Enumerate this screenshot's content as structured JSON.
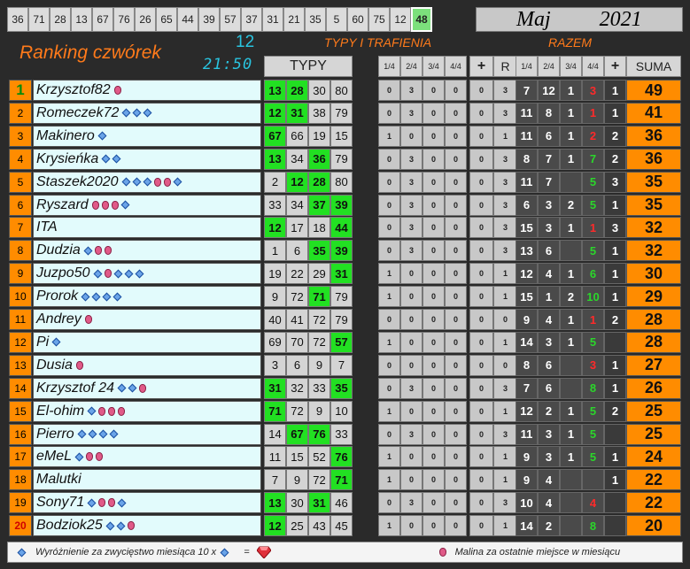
{
  "top_numbers": [
    "36",
    "71",
    "28",
    "13",
    "67",
    "76",
    "26",
    "65",
    "44",
    "39",
    "57",
    "37",
    "31",
    "21",
    "35",
    "5",
    "60",
    "75",
    "12",
    "48"
  ],
  "highlight_number": "48",
  "month": "Maj",
  "year": "2021",
  "title": "Ranking czwórek",
  "big_number": "12",
  "time": "21:50",
  "typy_trafienia": "TYPY I TRAFIENIA",
  "razem": "RAZEM",
  "headers": {
    "typy": "TYPY",
    "cols_left": [
      "1/4",
      "2/4",
      "3/4",
      "4/4",
      "+",
      "R"
    ],
    "cols_right": [
      "1/4",
      "2/4",
      "3/4",
      "4/4",
      "+",
      "SUMA"
    ]
  },
  "rows": [
    {
      "rank": "1",
      "name": "Krzysztof82",
      "icons": "r",
      "typy": [
        [
          "13",
          true
        ],
        [
          "28",
          true
        ],
        [
          "30",
          false
        ],
        [
          "80",
          false
        ]
      ],
      "left": [
        "0",
        "3",
        "0",
        "0",
        "0",
        "3"
      ],
      "right": [
        [
          "7",
          ""
        ],
        [
          "12",
          ""
        ],
        [
          "1",
          ""
        ],
        [
          "3",
          "red"
        ]
      ],
      "plus": "1",
      "suma": "49"
    },
    {
      "rank": "2",
      "name": "Romeczek72",
      "icons": "ddd",
      "typy": [
        [
          "12",
          true
        ],
        [
          "31",
          true
        ],
        [
          "38",
          false
        ],
        [
          "79",
          false
        ]
      ],
      "left": [
        "0",
        "3",
        "0",
        "0",
        "0",
        "3"
      ],
      "right": [
        [
          "11",
          ""
        ],
        [
          "8",
          ""
        ],
        [
          "1",
          ""
        ],
        [
          "1",
          "red"
        ]
      ],
      "plus": "1",
      "suma": "41"
    },
    {
      "rank": "3",
      "name": "Makinero",
      "icons": "d",
      "typy": [
        [
          "67",
          true
        ],
        [
          "66",
          false
        ],
        [
          "19",
          false
        ],
        [
          "15",
          false
        ]
      ],
      "left": [
        "1",
        "0",
        "0",
        "0",
        "0",
        "1"
      ],
      "right": [
        [
          "11",
          ""
        ],
        [
          "6",
          ""
        ],
        [
          "1",
          ""
        ],
        [
          "2",
          "red"
        ]
      ],
      "plus": "2",
      "suma": "36"
    },
    {
      "rank": "4",
      "name": "Krysieńka",
      "icons": "dd",
      "typy": [
        [
          "13",
          true
        ],
        [
          "34",
          false
        ],
        [
          "36",
          true
        ],
        [
          "79",
          false
        ]
      ],
      "left": [
        "0",
        "3",
        "0",
        "0",
        "0",
        "3"
      ],
      "right": [
        [
          "8",
          ""
        ],
        [
          "7",
          ""
        ],
        [
          "1",
          ""
        ],
        [
          "7",
          "grn"
        ]
      ],
      "plus": "2",
      "suma": "36"
    },
    {
      "rank": "5",
      "name": "Staszek2020",
      "icons": "dddrrd",
      "typy": [
        [
          "2",
          false
        ],
        [
          "12",
          true
        ],
        [
          "28",
          true
        ],
        [
          "80",
          false
        ]
      ],
      "left": [
        "0",
        "3",
        "0",
        "0",
        "0",
        "3"
      ],
      "right": [
        [
          "11",
          ""
        ],
        [
          "7",
          ""
        ],
        [
          "",
          ""
        ],
        [
          "5",
          "grn"
        ]
      ],
      "plus": "3",
      "suma": "35"
    },
    {
      "rank": "6",
      "name": "Ryszard",
      "icons": "rrrd",
      "typy": [
        [
          "33",
          false
        ],
        [
          "34",
          false
        ],
        [
          "37",
          true
        ],
        [
          "39",
          true
        ]
      ],
      "left": [
        "0",
        "3",
        "0",
        "0",
        "0",
        "3"
      ],
      "right": [
        [
          "6",
          ""
        ],
        [
          "3",
          ""
        ],
        [
          "2",
          ""
        ],
        [
          "5",
          "grn"
        ]
      ],
      "plus": "1",
      "suma": "35"
    },
    {
      "rank": "7",
      "name": "ITA",
      "icons": "",
      "typy": [
        [
          "12",
          true
        ],
        [
          "17",
          false
        ],
        [
          "18",
          false
        ],
        [
          "44",
          true
        ]
      ],
      "left": [
        "0",
        "3",
        "0",
        "0",
        "0",
        "3"
      ],
      "right": [
        [
          "15",
          ""
        ],
        [
          "3",
          ""
        ],
        [
          "1",
          ""
        ],
        [
          "1",
          "red"
        ]
      ],
      "plus": "3",
      "suma": "32"
    },
    {
      "rank": "8",
      "name": "Dudzia",
      "icons": "drr",
      "typy": [
        [
          "1",
          false
        ],
        [
          "6",
          false
        ],
        [
          "35",
          true
        ],
        [
          "39",
          true
        ]
      ],
      "left": [
        "0",
        "3",
        "0",
        "0",
        "0",
        "3"
      ],
      "right": [
        [
          "13",
          ""
        ],
        [
          "6",
          ""
        ],
        [
          "",
          ""
        ],
        [
          "5",
          "grn"
        ]
      ],
      "plus": "1",
      "suma": "32"
    },
    {
      "rank": "9",
      "name": "Juzpo50",
      "icons": "drddd",
      "typy": [
        [
          "19",
          false
        ],
        [
          "22",
          false
        ],
        [
          "29",
          false
        ],
        [
          "31",
          true
        ]
      ],
      "left": [
        "1",
        "0",
        "0",
        "0",
        "0",
        "1"
      ],
      "right": [
        [
          "12",
          ""
        ],
        [
          "4",
          ""
        ],
        [
          "1",
          ""
        ],
        [
          "6",
          "grn"
        ]
      ],
      "plus": "1",
      "suma": "30"
    },
    {
      "rank": "10",
      "name": "Prorok",
      "icons": "dddd",
      "typy": [
        [
          "9",
          false
        ],
        [
          "72",
          false
        ],
        [
          "71",
          true
        ],
        [
          "79",
          false
        ]
      ],
      "left": [
        "1",
        "0",
        "0",
        "0",
        "0",
        "1"
      ],
      "right": [
        [
          "15",
          ""
        ],
        [
          "1",
          ""
        ],
        [
          "2",
          ""
        ],
        [
          "10",
          "grn"
        ]
      ],
      "plus": "1",
      "suma": "29"
    },
    {
      "rank": "11",
      "name": "Andrey",
      "icons": "r",
      "typy": [
        [
          "40",
          false
        ],
        [
          "41",
          false
        ],
        [
          "72",
          false
        ],
        [
          "79",
          false
        ]
      ],
      "left": [
        "0",
        "0",
        "0",
        "0",
        "0",
        "0"
      ],
      "right": [
        [
          "9",
          ""
        ],
        [
          "4",
          ""
        ],
        [
          "1",
          ""
        ],
        [
          "1",
          "red"
        ]
      ],
      "plus": "2",
      "suma": "28"
    },
    {
      "rank": "12",
      "name": "Pi",
      "icons": "d",
      "typy": [
        [
          "69",
          false
        ],
        [
          "70",
          false
        ],
        [
          "72",
          false
        ],
        [
          "57",
          true
        ]
      ],
      "left": [
        "1",
        "0",
        "0",
        "0",
        "0",
        "1"
      ],
      "right": [
        [
          "14",
          ""
        ],
        [
          "3",
          ""
        ],
        [
          "1",
          ""
        ],
        [
          "5",
          "grn"
        ]
      ],
      "plus": "",
      "suma": "28"
    },
    {
      "rank": "13",
      "name": "Dusia",
      "icons": "r",
      "typy": [
        [
          "3",
          false
        ],
        [
          "6",
          false
        ],
        [
          "9",
          false
        ],
        [
          "7",
          false
        ]
      ],
      "left": [
        "0",
        "0",
        "0",
        "0",
        "0",
        "0"
      ],
      "right": [
        [
          "8",
          ""
        ],
        [
          "6",
          ""
        ],
        [
          "",
          ""
        ],
        [
          "3",
          "red"
        ]
      ],
      "plus": "1",
      "suma": "27"
    },
    {
      "rank": "14",
      "name": "Krzysztof 24",
      "icons": "ddr",
      "typy": [
        [
          "31",
          true
        ],
        [
          "32",
          false
        ],
        [
          "33",
          false
        ],
        [
          "35",
          true
        ]
      ],
      "left": [
        "0",
        "3",
        "0",
        "0",
        "0",
        "3"
      ],
      "right": [
        [
          "7",
          ""
        ],
        [
          "6",
          ""
        ],
        [
          "",
          ""
        ],
        [
          "8",
          "grn"
        ]
      ],
      "plus": "1",
      "suma": "26"
    },
    {
      "rank": "15",
      "name": "El-ohim",
      "icons": "drrr",
      "typy": [
        [
          "71",
          true
        ],
        [
          "72",
          false
        ],
        [
          "9",
          false
        ],
        [
          "10",
          false
        ]
      ],
      "left": [
        "1",
        "0",
        "0",
        "0",
        "0",
        "1"
      ],
      "right": [
        [
          "12",
          ""
        ],
        [
          "2",
          ""
        ],
        [
          "1",
          ""
        ],
        [
          "5",
          "grn"
        ]
      ],
      "plus": "2",
      "suma": "25"
    },
    {
      "rank": "16",
      "name": "Pierro",
      "icons": "dddd",
      "typy": [
        [
          "14",
          false
        ],
        [
          "67",
          true
        ],
        [
          "76",
          true
        ],
        [
          "33",
          false
        ]
      ],
      "left": [
        "0",
        "3",
        "0",
        "0",
        "0",
        "3"
      ],
      "right": [
        [
          "11",
          ""
        ],
        [
          "3",
          ""
        ],
        [
          "1",
          ""
        ],
        [
          "5",
          "grn"
        ]
      ],
      "plus": "",
      "suma": "25"
    },
    {
      "rank": "17",
      "name": "eMeL",
      "icons": "drr",
      "typy": [
        [
          "11",
          false
        ],
        [
          "15",
          false
        ],
        [
          "52",
          false
        ],
        [
          "76",
          true
        ]
      ],
      "left": [
        "1",
        "0",
        "0",
        "0",
        "0",
        "1"
      ],
      "right": [
        [
          "9",
          ""
        ],
        [
          "3",
          ""
        ],
        [
          "1",
          ""
        ],
        [
          "5",
          "grn"
        ]
      ],
      "plus": "1",
      "suma": "24"
    },
    {
      "rank": "18",
      "name": "Malutki",
      "icons": "",
      "typy": [
        [
          "7",
          false
        ],
        [
          "9",
          false
        ],
        [
          "72",
          false
        ],
        [
          "71",
          true
        ]
      ],
      "left": [
        "1",
        "0",
        "0",
        "0",
        "0",
        "1"
      ],
      "right": [
        [
          "9",
          ""
        ],
        [
          "4",
          ""
        ],
        [
          "",
          ""
        ],
        [
          "",
          ""
        ]
      ],
      "plus": "1",
      "suma": "22"
    },
    {
      "rank": "19",
      "name": "Sony71",
      "icons": "drrd",
      "typy": [
        [
          "13",
          true
        ],
        [
          "30",
          false
        ],
        [
          "31",
          true
        ],
        [
          "46",
          false
        ]
      ],
      "left": [
        "0",
        "3",
        "0",
        "0",
        "0",
        "3"
      ],
      "right": [
        [
          "10",
          ""
        ],
        [
          "4",
          ""
        ],
        [
          "",
          ""
        ],
        [
          "4",
          "red"
        ]
      ],
      "plus": "",
      "suma": "22"
    },
    {
      "rank": "20",
      "name": "Bodziok25",
      "icons": "ddr",
      "typy": [
        [
          "12",
          true
        ],
        [
          "25",
          false
        ],
        [
          "43",
          false
        ],
        [
          "45",
          false
        ]
      ],
      "left": [
        "1",
        "0",
        "0",
        "0",
        "0",
        "1"
      ],
      "right": [
        [
          "14",
          ""
        ],
        [
          "2",
          ""
        ],
        [
          "",
          ""
        ],
        [
          "8",
          "grn"
        ]
      ],
      "plus": "",
      "suma": "20"
    }
  ],
  "legend": {
    "left": "Wyróżnienie za zwycięstwo miesiąca  10 x",
    "eq": "=",
    "right": "Malina za ostatnie miejsce w miesiącu"
  },
  "colors": {
    "accent": "#ff8c00",
    "hit": "#22e022",
    "cyan": "#29c4e0"
  }
}
